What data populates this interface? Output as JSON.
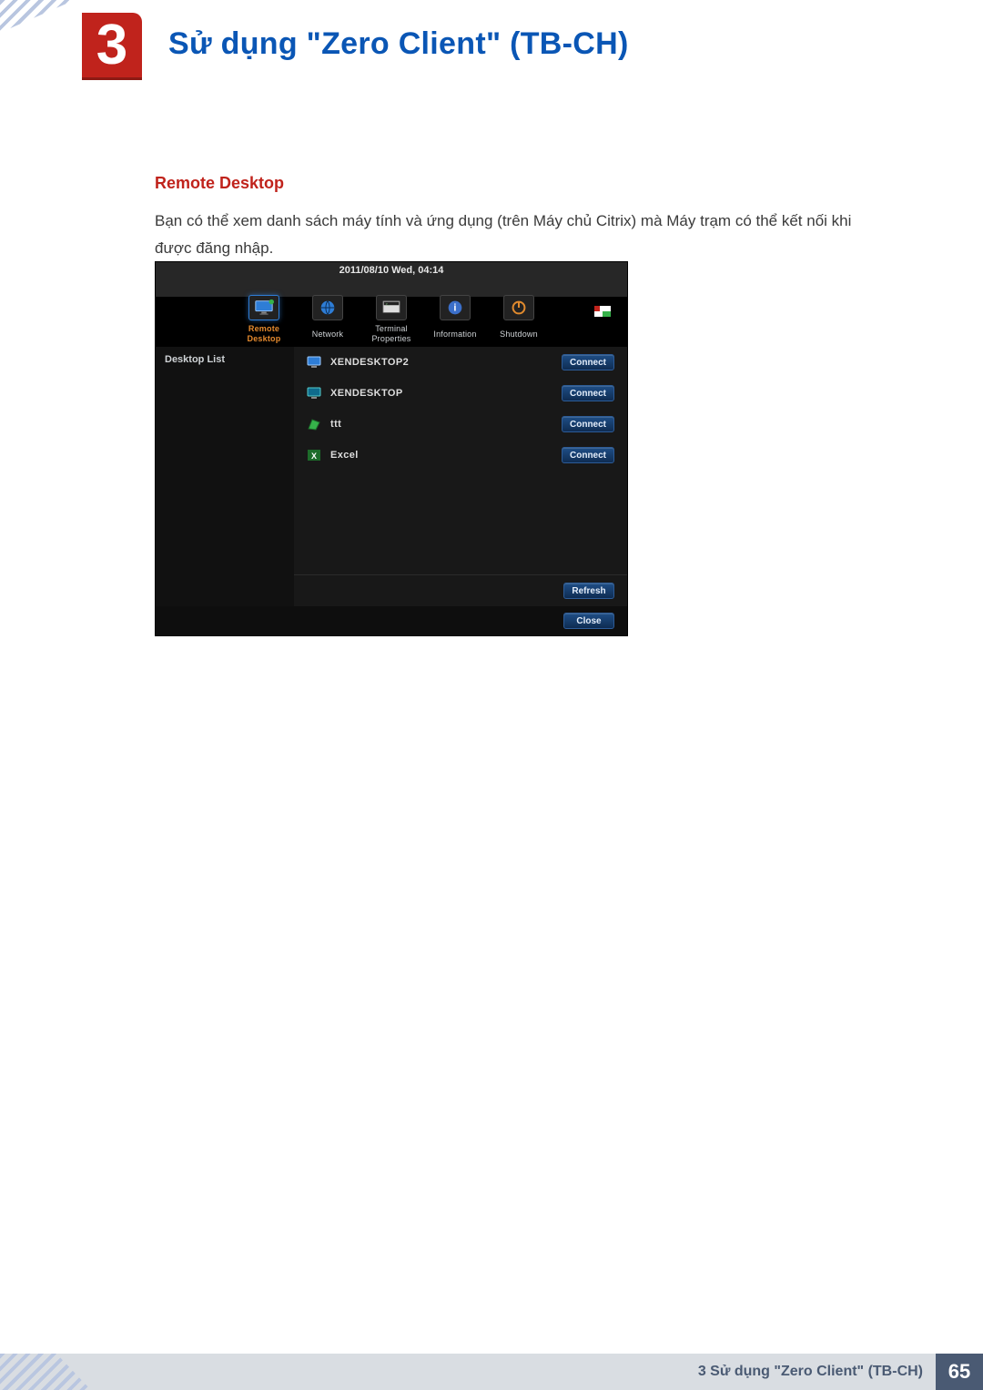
{
  "chapter": {
    "number": "3",
    "title": "Sử dụng \"Zero Client\" (TB-CH)"
  },
  "section": {
    "heading": "Remote Desktop",
    "body": "Bạn có thể xem danh sách máy tính và ứng dụng (trên Máy chủ Citrix) mà Máy trạm có thể kết nối khi được đăng nhập."
  },
  "shot": {
    "datetime": "2011/08/10 Wed, 04:14",
    "toolbar": [
      {
        "label": "Remote Desktop",
        "icon": "monitor",
        "active": true
      },
      {
        "label": "Network",
        "icon": "globe",
        "active": false
      },
      {
        "label": "Terminal Properties",
        "icon": "terminal",
        "active": false
      },
      {
        "label": "Information",
        "icon": "info",
        "active": false
      },
      {
        "label": "Shutdown",
        "icon": "power",
        "active": false
      }
    ],
    "sidebar_label": "Desktop List",
    "items": [
      {
        "label": "XENDESKTOP2",
        "icon": "desktop-blue",
        "connect": "Connect"
      },
      {
        "label": "XENDESKTOP",
        "icon": "desktop-teal",
        "connect": "Connect"
      },
      {
        "label": "ttt",
        "icon": "app-green",
        "connect": "Connect"
      },
      {
        "label": "Excel",
        "icon": "excel",
        "connect": "Connect"
      }
    ],
    "refresh_label": "Refresh",
    "close_label": "Close"
  },
  "footer": {
    "text": "3 Sử dụng \"Zero Client\" (TB-CH)",
    "page": "65"
  }
}
